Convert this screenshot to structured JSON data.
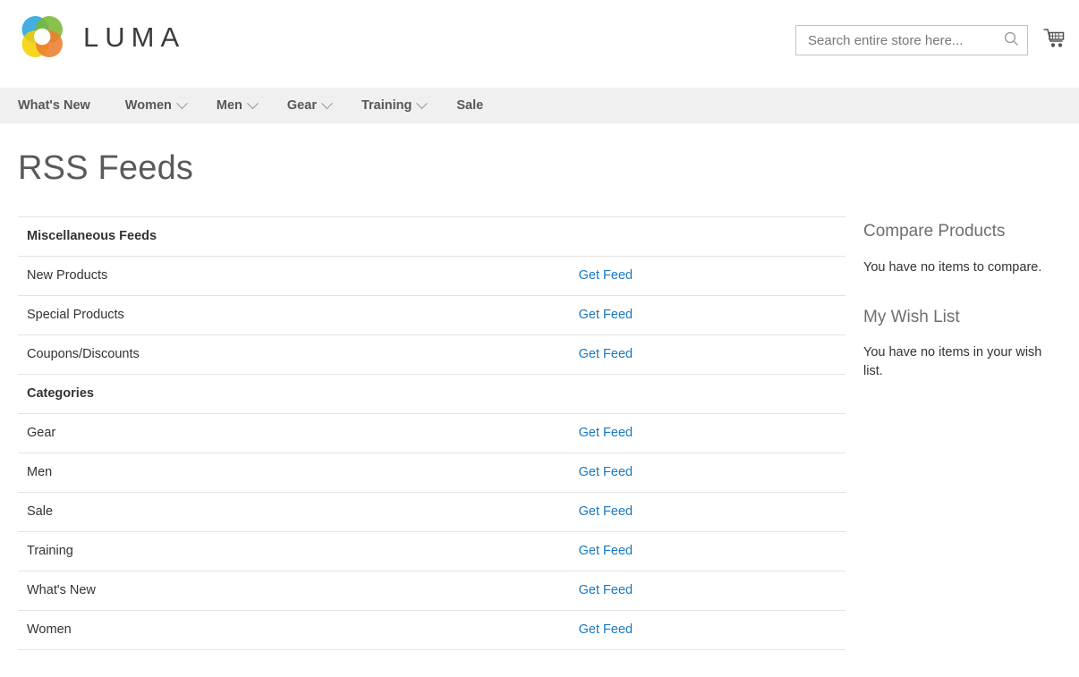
{
  "header": {
    "logo_text": "LUMA",
    "logo_icon": "luma-flower-logo",
    "logo_colors": {
      "blue": "#29a4dd",
      "green": "#79b833",
      "yellow": "#f4d200",
      "orange": "#ec7d2d"
    },
    "search": {
      "placeholder": "Search entire store here...",
      "value": "",
      "icon": "search-icon"
    },
    "cart": {
      "icon": "shopping-cart-icon",
      "count": ""
    }
  },
  "nav": {
    "items": [
      {
        "label": "What's New",
        "has_caret": false
      },
      {
        "label": "Women",
        "has_caret": true
      },
      {
        "label": "Men",
        "has_caret": true
      },
      {
        "label": "Gear",
        "has_caret": true
      },
      {
        "label": "Training",
        "has_caret": true
      },
      {
        "label": "Sale",
        "has_caret": false
      }
    ]
  },
  "main": {
    "page_title": "RSS Feeds",
    "link_label": "Get Feed",
    "link_color": "#1979c3",
    "rows": [
      {
        "type": "header",
        "label": "Miscellaneous Feeds",
        "link": ""
      },
      {
        "type": "row",
        "label": "New Products",
        "link": "Get Feed"
      },
      {
        "type": "row",
        "label": "Special Products",
        "link": "Get Feed"
      },
      {
        "type": "row",
        "label": "Coupons/Discounts",
        "link": "Get Feed"
      },
      {
        "type": "header",
        "label": "Categories",
        "link": ""
      },
      {
        "type": "row",
        "label": "Gear",
        "link": "Get Feed"
      },
      {
        "type": "row",
        "label": "Men",
        "link": "Get Feed"
      },
      {
        "type": "row",
        "label": "Sale",
        "link": "Get Feed"
      },
      {
        "type": "row",
        "label": "Training",
        "link": "Get Feed"
      },
      {
        "type": "row",
        "label": "What's New",
        "link": "Get Feed"
      },
      {
        "type": "row",
        "label": "Women",
        "link": "Get Feed"
      }
    ]
  },
  "sidebar": {
    "blocks": [
      {
        "title": "Compare Products",
        "text": "You have no items to compare."
      },
      {
        "title": "My Wish List",
        "text": "You have no items in your wish list."
      }
    ]
  }
}
